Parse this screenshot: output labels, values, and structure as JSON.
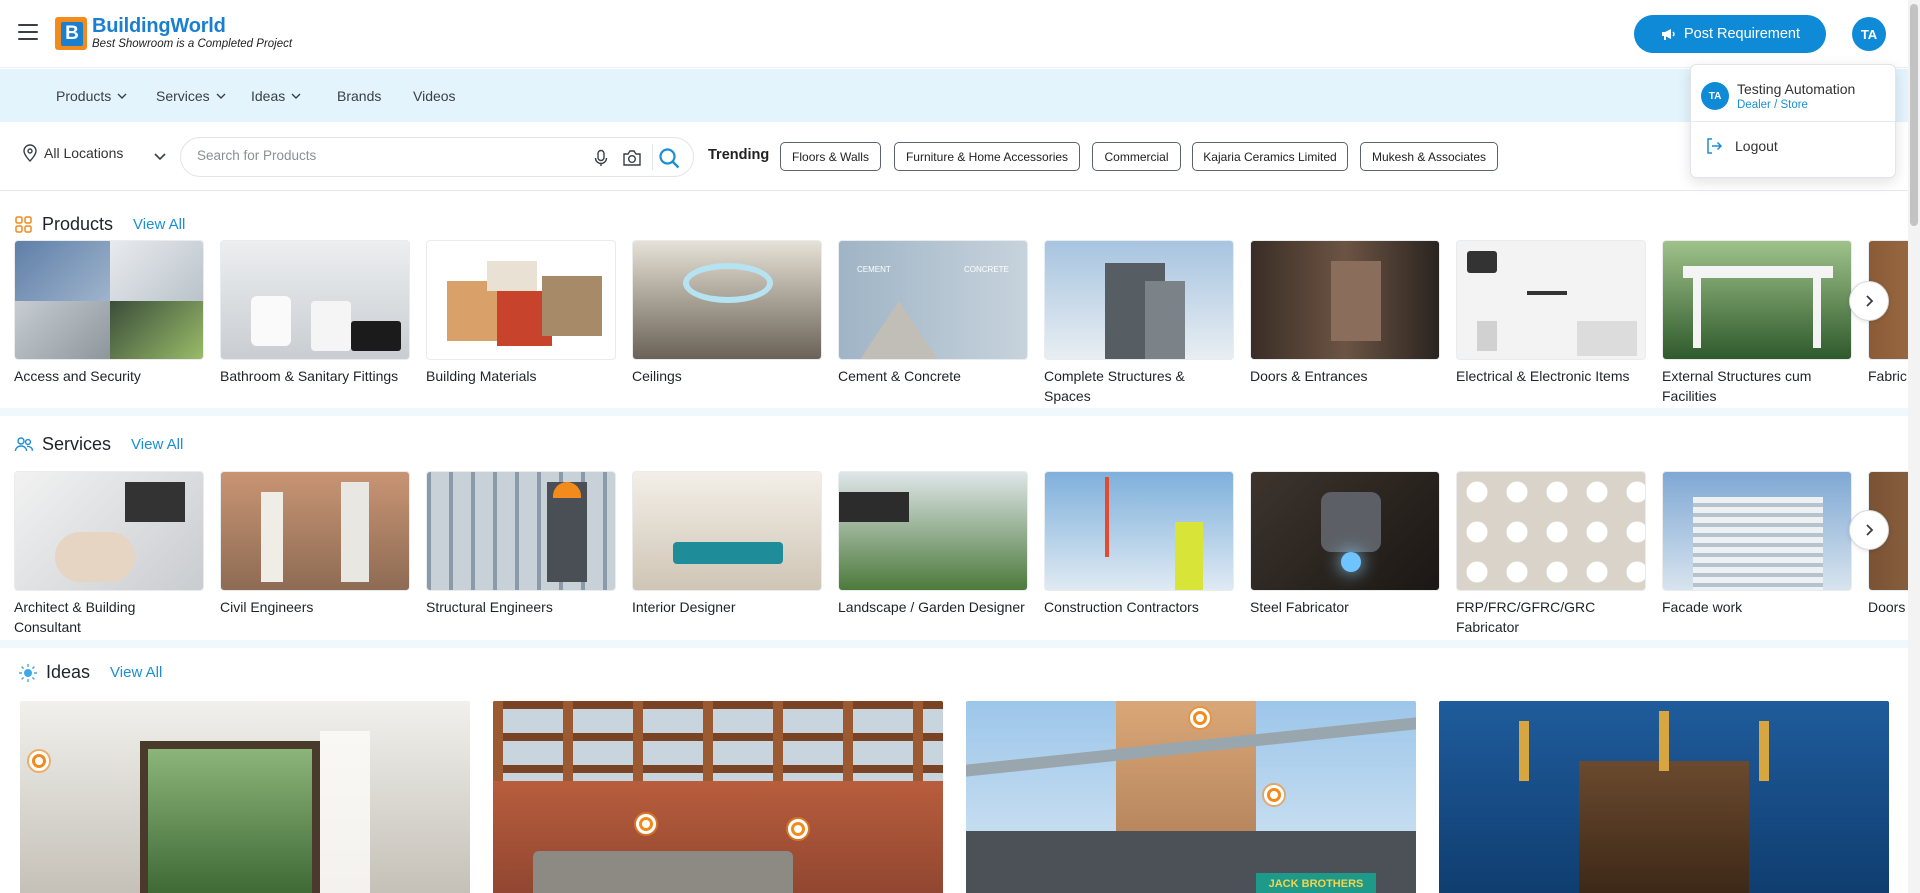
{
  "brand": {
    "name": "BuildingWorld",
    "tagline": "Best Showroom is a Completed Project",
    "logo_letter": "B"
  },
  "header": {
    "post_requirement_label": "Post Requirement",
    "user_initials": "TA"
  },
  "nav": {
    "items": [
      {
        "label": "Products",
        "has_dropdown": true
      },
      {
        "label": "Services",
        "has_dropdown": true
      },
      {
        "label": "Ideas",
        "has_dropdown": true
      },
      {
        "label": "Brands",
        "has_dropdown": false
      },
      {
        "label": "Videos",
        "has_dropdown": false
      }
    ]
  },
  "search": {
    "location_label": "All Locations",
    "placeholder": "Search for Products",
    "trending_label": "Trending",
    "trending_chips": [
      "Floors & Walls",
      "Furniture & Home Accessories",
      "Commercial",
      "Kajaria Ceramics Limited",
      "Mukesh & Associates"
    ]
  },
  "products": {
    "title": "Products",
    "view_all": "View All",
    "items": [
      "Access and Security",
      "Bathroom & Sanitary Fittings",
      "Building Materials",
      "Ceilings",
      "Cement & Concrete",
      "Complete Structures & Spaces",
      "Doors & Entrances",
      "Electrical & Electronic Items",
      "External Structures cum Facilities",
      "Fabric"
    ],
    "cement_img_labels": [
      "CEMENT",
      "CONCRETE"
    ]
  },
  "services": {
    "title": "Services",
    "view_all": "View All",
    "items": [
      "Architect & Building Consultant",
      "Civil Engineers",
      "Structural Engineers",
      "Interior Designer",
      "Landscape / Garden Designer",
      "Construction Contractors",
      "Steel Fabricator",
      "FRP/FRC/GFRC/GRC Fabricator",
      "Facade work",
      "Doors"
    ]
  },
  "ideas": {
    "title": "Ideas",
    "view_all": "View All",
    "store_sign": "JACK BROTHERS"
  },
  "user_menu": {
    "initials": "TA",
    "name": "Testing Automation",
    "role": "Dealer / Store",
    "logout_label": "Logout"
  },
  "colors": {
    "brand_blue": "#0f8ad6",
    "brand_orange": "#f28a1c",
    "nav_bg": "#e3f4fc"
  }
}
